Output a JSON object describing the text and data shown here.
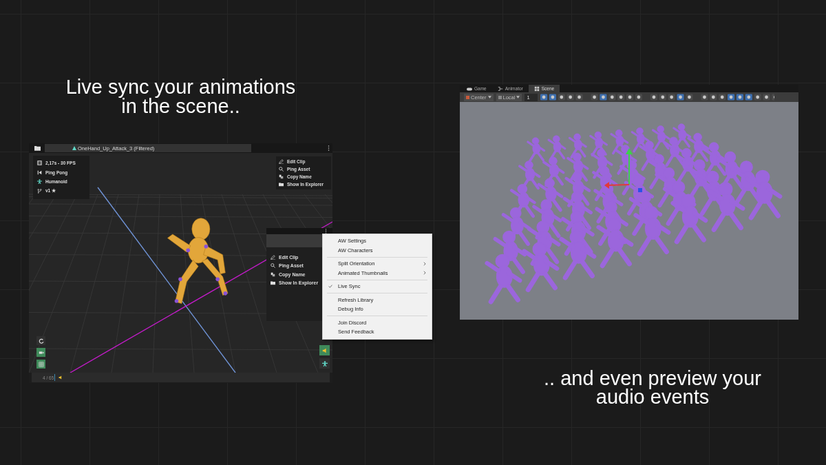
{
  "headline": "Live sync your animations in the scene..",
  "clip_window": {
    "tab": {
      "label": "OneHand_Up_Attack_3 (Filtered)",
      "selected": true
    },
    "info": [
      {
        "kind": "duration",
        "text": "2,17s - 30 FPS"
      },
      {
        "kind": "loop",
        "text": "Ping Pong"
      },
      {
        "kind": "rig",
        "text": "Humanoid"
      },
      {
        "kind": "version",
        "text": "v1 ★"
      }
    ],
    "actions": [
      {
        "kind": "edit",
        "label": "Edit Clip"
      },
      {
        "kind": "ping",
        "label": "Ping Asset"
      },
      {
        "kind": "copy",
        "label": "Copy Name"
      },
      {
        "kind": "folder",
        "label": "Show In Explorer"
      }
    ],
    "left_tools": [
      {
        "kind": "refresh",
        "on": false
      },
      {
        "kind": "camera",
        "on": true
      },
      {
        "kind": "grid",
        "on": true
      }
    ],
    "right_tools": [
      {
        "kind": "audio",
        "on": true
      },
      {
        "kind": "humanoid",
        "on": false
      }
    ],
    "timeline": {
      "frame": "4 / 65"
    }
  },
  "second_window": {
    "actions": [
      {
        "kind": "edit",
        "label": "Edit Clip"
      },
      {
        "kind": "ping",
        "label": "Ping Asset"
      },
      {
        "kind": "copy",
        "label": "Copy Name"
      },
      {
        "kind": "folder",
        "label": "Show In Explorer"
      }
    ]
  },
  "context_menu": {
    "groups": [
      {
        "items": [
          {
            "label": "AW Settings",
            "checked": false,
            "submenu": false
          },
          {
            "label": "AW Characters",
            "checked": false,
            "submenu": false
          }
        ]
      },
      {
        "items": [
          {
            "label": "Split Orientation",
            "checked": false,
            "submenu": true
          },
          {
            "label": "Animated Thumbnails",
            "checked": false,
            "submenu": true
          }
        ]
      },
      {
        "items": [
          {
            "label": "Live Sync",
            "checked": true,
            "submenu": false
          }
        ]
      },
      {
        "items": [
          {
            "label": "Refresh Library",
            "checked": false,
            "submenu": false
          },
          {
            "label": "Debug Info",
            "checked": false,
            "submenu": false
          }
        ]
      },
      {
        "items": [
          {
            "label": "Join Discord",
            "checked": false,
            "submenu": false
          },
          {
            "label": "Send Feedback",
            "checked": false,
            "submenu": false
          }
        ]
      }
    ]
  },
  "scene_window": {
    "tabs": [
      {
        "kind": "game",
        "label": "Game",
        "selected": false
      },
      {
        "kind": "animator",
        "label": "Animator",
        "selected": false
      },
      {
        "kind": "scene",
        "label": "Scene",
        "selected": true
      }
    ],
    "toolbar": {
      "pivot": "Center",
      "space": "Local",
      "snap": "1"
    }
  },
  "caption": ".. and even preview your audio events"
}
